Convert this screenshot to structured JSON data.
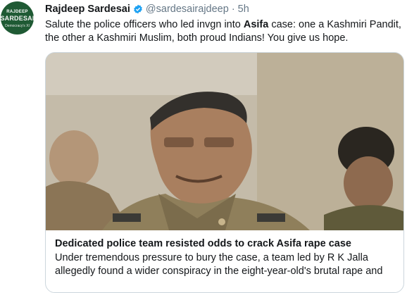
{
  "author": {
    "name": "Rajdeep Sardesai",
    "handle": "@sardesairajdeep",
    "separator": "·",
    "time": "5h",
    "avatar_text": {
      "line1": "RAJDEEP",
      "line2": "SARDESAI",
      "line3": "Democracy's XI"
    }
  },
  "tweet": {
    "text_before": "Salute the police officers who led invgn into ",
    "text_bold": "Asifa",
    "text_after": " case: one a Kashmiri Pandit, the other a Kashmiri Muslim, both proud Indians! You give us hope."
  },
  "card": {
    "title": "Dedicated police team resisted odds to crack Asifa rape case",
    "description": "Under tremendous pressure to bury the case, a team led by R K Jalla allegedly found a wider conspiracy in the eight-year-old's brutal rape and"
  },
  "colors": {
    "verified": "#1da1f2",
    "muted": "#657786",
    "border": "#ccd6dd",
    "avatar_bg": "#1f5a34"
  }
}
